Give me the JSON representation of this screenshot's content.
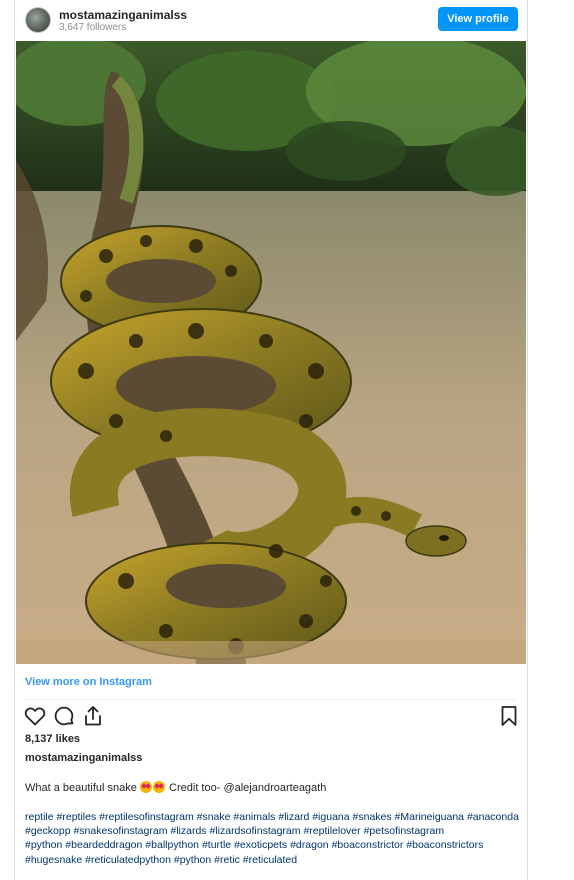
{
  "header": {
    "username": "mostamazinganimalss",
    "followers": "3,647 followers",
    "view_profile": "View profile"
  },
  "view_more": "View more on Instagram",
  "likes": "8,137 likes",
  "owner": "mostamazinganimalss",
  "caption": {
    "before": "What a beautiful snake",
    "after": "Credit too- @alejandroarteagath"
  },
  "hashtags": [
    "reptile",
    "#reptiles",
    "#reptilesofinstagram",
    "#snake",
    "#animals",
    "#lizard",
    "#iguana",
    "#snakes",
    "#Marineiguana",
    "#anaconda",
    "#geckopp",
    "#snakesofinstagram",
    "#lizards",
    "#lizardsofinstagram",
    "#reptilelover",
    "#petsofinstagram",
    "#python",
    "#beardeddragon",
    "#ballpython",
    "#turtle",
    "#exoticpets",
    "#dragon",
    "#boaconstrictor",
    "#boaconstrictors",
    "#hugesnake",
    "#reticulatedpython",
    "#python",
    "#retic",
    "#reticulated"
  ],
  "icons": [
    "heart-icon",
    "comment-icon",
    "share-icon",
    "bookmark-icon"
  ],
  "colors": {
    "accent": "#0095f6",
    "link": "#3897f0",
    "hashtag": "#003569"
  }
}
